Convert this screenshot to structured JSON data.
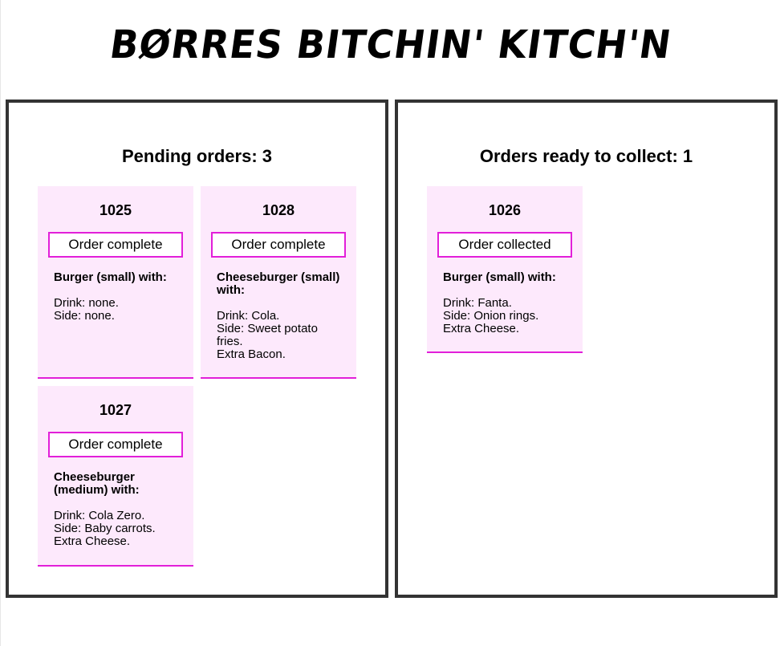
{
  "app": {
    "title": "BØRRES BITCHIN' KITCH'N"
  },
  "pending": {
    "heading": "Pending orders: 3",
    "orders": [
      {
        "number": "1025",
        "action": "Order complete",
        "item": "Burger (small) with:",
        "details": [
          "Drink: none.",
          "Side: none."
        ]
      },
      {
        "number": "1028",
        "action": "Order complete",
        "item": "Cheeseburger (small) with:",
        "details": [
          "Drink: Cola.",
          "Side: Sweet potato fries.",
          "Extra Bacon."
        ]
      },
      {
        "number": "1027",
        "action": "Order complete",
        "item": "Cheeseburger (medium) with:",
        "details": [
          "Drink: Cola Zero.",
          "Side: Baby carrots.",
          "Extra Cheese."
        ]
      }
    ]
  },
  "ready": {
    "heading": "Orders ready to collect: 1",
    "orders": [
      {
        "number": "1026",
        "action": "Order collected",
        "item": "Burger (small) with:",
        "details": [
          "Drink: Fanta.",
          "Side: Onion rings.",
          "Extra Cheese."
        ]
      }
    ]
  },
  "colors": {
    "card_bg": "#fde9fc",
    "accent": "#e21fd9",
    "panel_border": "#333333"
  }
}
